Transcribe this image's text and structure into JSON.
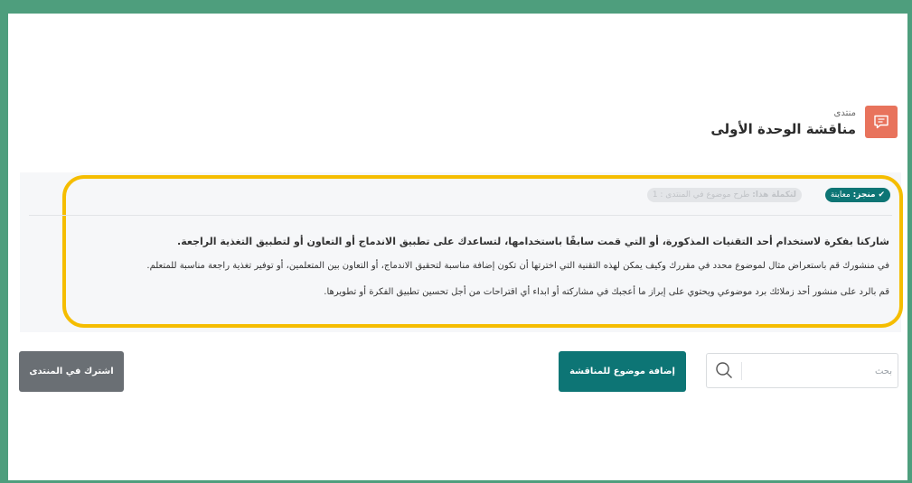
{
  "header": {
    "subtitle": "منتدى",
    "title": "مناقشة الوحدة الأولى",
    "icon": "forum-chat-icon",
    "icon_color": "#e8735c"
  },
  "completion": {
    "done_prefix": "منجز:",
    "done_label": "معاينة",
    "todo_prefix": "لتكملة هذا:",
    "todo_label": "طرح موضوع في المنتدى : 1"
  },
  "intro": {
    "heading": "شاركنا بفكرة لاستخدام أحد التقنيات المذكورة، أو التي قمت سابقًا باستخدامها، لتساعدك على تطبيق الاندماج أو التعاون أو لتطبيق التغذية الراجعة.",
    "paragraph1": "في منشورك قم باستعراض مثال لموضوع محدد في مقررك وكيف يمكن لهذه التقنية التي اخترتها أن تكون إضافة مناسبة لتحقيق الاندماج، أو التعاون بين المتعلمين، أو توفير تغذية راجعة مناسبة للمتعلم.",
    "paragraph2": "قم بالرد على منشور أحد زملائك برد موضوعي ويحتوي على إبراز ما أعجبك في مشاركته أو ابداء أي اقتراحات من أجل تحسين تطبيق الفكرة أو تطويرها."
  },
  "toolbar": {
    "search_placeholder": "بحث",
    "search_value": "",
    "add_topic_label": "إضافة موضوع للمناقشة",
    "subscribe_label": "اشترك في المنتدى"
  },
  "colors": {
    "frame": "#4e9e7d",
    "primary": "#0d7575",
    "highlight": "#f5bd00",
    "secondary_button": "#6a6f74"
  }
}
